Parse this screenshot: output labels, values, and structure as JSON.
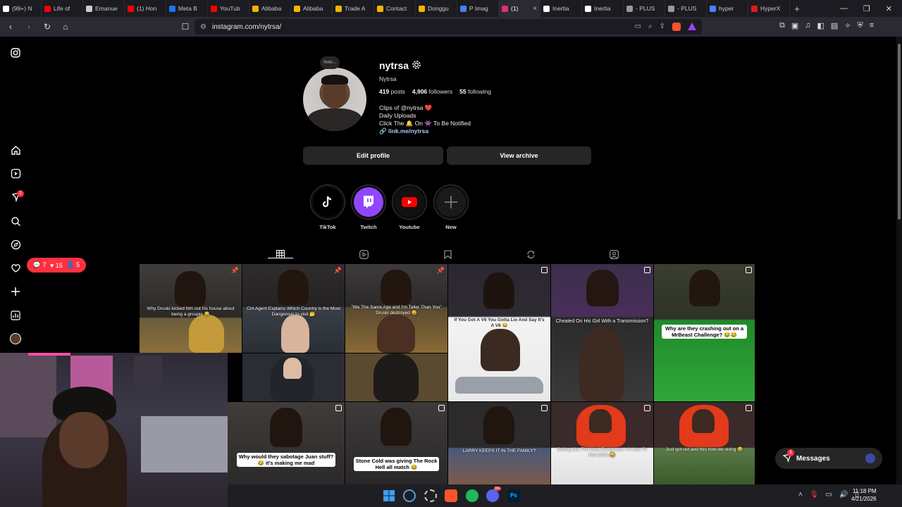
{
  "browser": {
    "tabs": [
      {
        "label": "(99+) N",
        "color": "#ffffff"
      },
      {
        "label": "Life of",
        "color": "#ff0000"
      },
      {
        "label": "Emanue",
        "color": "#cccccc"
      },
      {
        "label": "(1) Hon",
        "color": "#ff0000"
      },
      {
        "label": "Meta B",
        "color": "#1877f2"
      },
      {
        "label": "YouTub",
        "color": "#ff0000"
      },
      {
        "label": "Alibaba",
        "color": "#f5b400"
      },
      {
        "label": "Alibaba",
        "color": "#f5b400"
      },
      {
        "label": "Trade A",
        "color": "#f5b400"
      },
      {
        "label": "Contact",
        "color": "#f5b400"
      },
      {
        "label": "Donggu",
        "color": "#f5b400"
      },
      {
        "label": "P Imag",
        "color": "#4285f4"
      },
      {
        "label": "(1)",
        "color": "#e1306c",
        "active": true
      },
      {
        "label": "Inertia",
        "color": "#ffffff"
      },
      {
        "label": "Inertia",
        "color": "#ffffff"
      },
      {
        "label": "- PLUS",
        "color": "#999999"
      },
      {
        "label": "- PLUS",
        "color": "#999999"
      },
      {
        "label": "hyper",
        "color": "#4285f4"
      },
      {
        "label": "HyperX",
        "color": "#e21b1b"
      }
    ],
    "url": "instagram.com/nytrsa/"
  },
  "rail": {
    "notifications_badge": "1"
  },
  "notif_pill": {
    "comments": "7",
    "likes": "15",
    "follows": "5"
  },
  "profile": {
    "note": "Note...",
    "username": "nytrsa",
    "full_name": "Nytrsa",
    "posts": "419",
    "posts_label": "posts",
    "followers": "4,906",
    "followers_label": "followers",
    "following": "55",
    "following_label": "following",
    "bio": [
      "Clips of @nytrsa ❤️",
      "Daily Uploads",
      "Click The 🔔 On 👾 To Be Notified"
    ],
    "link": "link.me/nytrsa",
    "edit_profile": "Edit profile",
    "view_archive": "View archive"
  },
  "highlights": [
    {
      "label": "TikTok",
      "icon": "tiktok-icon",
      "color": "#000000"
    },
    {
      "label": "Twitch",
      "icon": "twitch-icon",
      "color": "#9146ff"
    },
    {
      "label": "Youtube",
      "icon": "youtube-icon",
      "color": "#ff0000"
    },
    {
      "label": "New",
      "icon": "plus-icon",
      "color": "#1a1a1a"
    }
  ],
  "grid": {
    "captions": [
      {
        "text": "Why Druski kicked him out his house about being a groupie 😂",
        "style": "white"
      },
      {
        "text": "CIA Agent Explains Which Country is the Most Dangerous to visit 🤔",
        "style": "white"
      },
      {
        "text": "\"We The Same Age and I'm Taller Than You\" Druski destroyed 😂",
        "style": "white"
      },
      {
        "text": "If You Got A V6 You Gotta Lie And Say It's A V8 😂",
        "style": "white"
      },
      {
        "text": "Cheated On His Girl With a Transmission?",
        "style": "white"
      },
      {
        "text": "Why are they crashing out on a MrBeast Challenge? 😂😂",
        "style": "box"
      },
      {
        "text": "Why would they sabotage Juan stuff? 😂 it's making me mad",
        "style": "box"
      },
      {
        "text": "Stone Cold was giving The Rock Hell all match 😂",
        "style": "box"
      },
      {
        "text": "LARRY KEEPS IT IN THE FAMILY?",
        "style": "white"
      },
      {
        "text": "Bailing Out The Most Dangerous YN Just To Run Drills 😂",
        "style": "white"
      },
      {
        "text": "Just got out and this how we doing 😂",
        "style": "white"
      }
    ]
  },
  "messages": {
    "label": "Messages",
    "badge": "1"
  },
  "taskbar": {
    "time": "11:18 PM",
    "date": "4/21/2026",
    "discord_badge": "99+"
  }
}
